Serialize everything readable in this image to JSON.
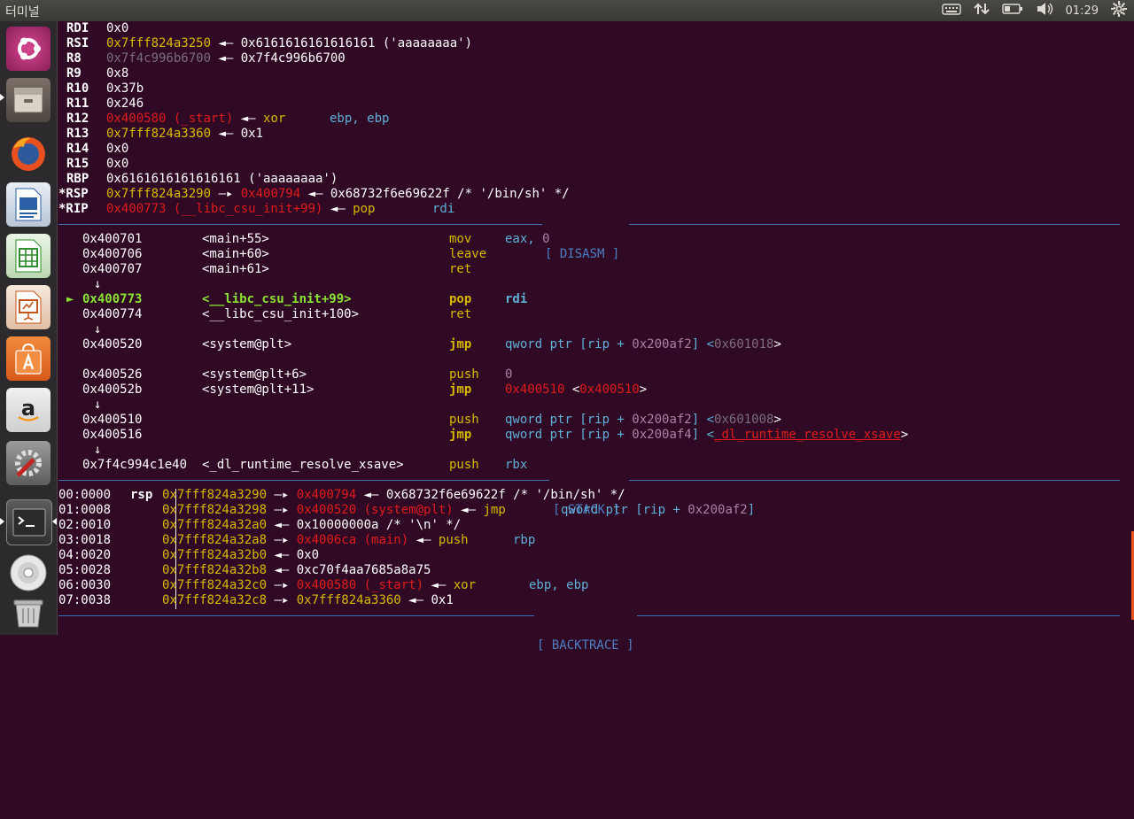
{
  "topbar": {
    "app_title": "터미널",
    "keyboard_icon": "keyboard-icon",
    "network_icon": "network-updown-icon",
    "battery_icon": "battery-icon",
    "volume_icon": "volume-icon",
    "clock": "01:29",
    "settings_icon": "gear-icon"
  },
  "launcher": {
    "items": [
      {
        "name": "ubuntu-dash-icon"
      },
      {
        "name": "files-icon"
      },
      {
        "name": "firefox-icon"
      },
      {
        "name": "libreoffice-writer-icon"
      },
      {
        "name": "libreoffice-calc-icon"
      },
      {
        "name": "libreoffice-impress-icon"
      },
      {
        "name": "software-center-icon"
      },
      {
        "name": "amazon-icon"
      },
      {
        "name": "system-settings-icon"
      },
      {
        "name": "terminal-icon"
      },
      {
        "name": "dvd-icon"
      },
      {
        "name": "trash-icon"
      }
    ]
  },
  "regs": [
    {
      "name": "RDI",
      "a": "0x0"
    },
    {
      "name": "RSI",
      "addr": "0x7fff824a3250",
      "arrow": " ◄— ",
      "val": "0x6161616161616161 ('aaaaaaaa')"
    },
    {
      "name": "R8",
      "addr": "0x7f4c996b6700",
      "arrow": " ◄— ",
      "val": "0x7f4c996b6700"
    },
    {
      "name": "R9",
      "a": "0x8"
    },
    {
      "name": "R10",
      "a": "0x37b"
    },
    {
      "name": "R11",
      "a": "0x246"
    },
    {
      "name": "R12",
      "addr": "0x400580 (_start)",
      "arrow": " ◄— ",
      "mn": "xor",
      "op": "ebp, ebp"
    },
    {
      "name": "R13",
      "addr": "0x7fff824a3360",
      "arrow": " ◄— ",
      "val": "0x1"
    },
    {
      "name": "R14",
      "a": "0x0"
    },
    {
      "name": "R15",
      "a": "0x0"
    },
    {
      "name": "RBP",
      "a": "0x6161616161616161 ('aaaaaaaa')"
    },
    {
      "name": "*RSP",
      "addr": "0x7fff824a3290",
      "arrow1": " —▸ ",
      "addr2": "0x400794",
      "arrow": " ◄— ",
      "val": "0x68732f6e69622f /* '/bin/sh' */"
    },
    {
      "name": "*RIP",
      "addr": "0x400773 (__libc_csu_init+99)",
      "arrow": " ◄— ",
      "mn": "pop",
      "op": "rdi"
    }
  ],
  "disasm_header": "[ DISASM ]",
  "disasm": [
    {
      "addr": "0x400701",
      "sym": "<main+55>",
      "mn": "mov",
      "op1": "eax, ",
      "op2": "0"
    },
    {
      "addr": "0x400706",
      "sym": "<main+60>",
      "mn": "leave"
    },
    {
      "addr": "0x400707",
      "sym": "<main+61>",
      "mn": "ret"
    },
    {
      "addr": "0x400773",
      "sym": "<__libc_csu_init+99>",
      "mn": "pop",
      "op1": "rdi",
      "current": "►"
    },
    {
      "addr": "0x400774",
      "sym": "<__libc_csu_init+100>",
      "mn": "ret"
    },
    {
      "addr": "0x400520",
      "sym": "<system@plt>",
      "mn": "jmp",
      "op1": "qword ptr [rip + ",
      "op2": "0x200af2",
      "op3": "] <",
      "op4": "0x601018",
      "op5": ">"
    },
    {
      "addr": "0x400526",
      "sym": "<system@plt+6>",
      "mn": "push",
      "op1": "0"
    },
    {
      "addr": "0x40052b",
      "sym": "<system@plt+11>",
      "mn": "jmp",
      "op1": "0x400510",
      "op2": " <",
      "op3": "0x400510",
      "op4": ">"
    },
    {
      "addr": "0x400510",
      "mn": "push",
      "op1": "qword ptr [rip + ",
      "op2": "0x200af2",
      "op3": "] <",
      "op4": "0x601008",
      "op5": ">"
    },
    {
      "addr": "0x400516",
      "mn": "jmp",
      "op1": "qword ptr [rip + ",
      "op2": "0x200af4",
      "op3": "] <",
      "op4": "_dl_runtime_resolve_xsave",
      "op5": ">"
    },
    {
      "addr": "0x7f4c994c1e40",
      "sym": "<_dl_runtime_resolve_xsave>",
      "mn": "push",
      "op1": "rbx"
    }
  ],
  "down_arrow": "↓",
  "stack_header": "[ STACK ]",
  "stack": [
    {
      "off": "00:0000",
      "reg": "rsp",
      "addr": "0x7fff824a3290",
      "a1": " —▸ ",
      "v1": "0x400794",
      "a2": " ◄— ",
      "rest": "0x68732f6e69622f /* '/bin/sh' */"
    },
    {
      "off": "01:0008",
      "addr": "0x7fff824a3298",
      "a1": " —▸ ",
      "v1": "0x400520 (system@plt)",
      "a2": " ◄— ",
      "mn": "jmp",
      "rest": "qword ptr [rip + ",
      "rest2": "0x200af2",
      "rest3": "]"
    },
    {
      "off": "02:0010",
      "addr": "0x7fff824a32a0",
      "a1": " ◄— ",
      "rest": "0x10000000a /* '\\n' */"
    },
    {
      "off": "03:0018",
      "addr": "0x7fff824a32a8",
      "a1": " —▸ ",
      "v1": "0x4006ca (main)",
      "a2": " ◄— ",
      "mn": "push",
      "reg2": "rbp"
    },
    {
      "off": "04:0020",
      "addr": "0x7fff824a32b0",
      "a1": " ◄— ",
      "rest": "0x0"
    },
    {
      "off": "05:0028",
      "addr": "0x7fff824a32b8",
      "a1": " ◄— ",
      "rest": "0xc70f4aa7685a8a75"
    },
    {
      "off": "06:0030",
      "addr": "0x7fff824a32c0",
      "a1": " —▸ ",
      "v1": "0x400580 (_start)",
      "a2": " ◄— ",
      "mn": "xor",
      "reg2": "ebp, ebp"
    },
    {
      "off": "07:0038",
      "addr": "0x7fff824a32c8",
      "a1": " —▸ ",
      "v2": "0x7fff824a3360",
      "a2": " ◄— ",
      "rest": "0x1"
    }
  ],
  "backtrace_header": "[ BACKTRACE ]",
  "colors": {
    "background": "#300a24",
    "panel": "#3c3b37",
    "launcher": "#2d2a2e",
    "yellow": "#d7b900",
    "red": "#e01b1b",
    "green": "#5fd72a",
    "cyan": "#5fafd7",
    "purple": "#ad7fa8",
    "rule": "#3e6fb0"
  }
}
